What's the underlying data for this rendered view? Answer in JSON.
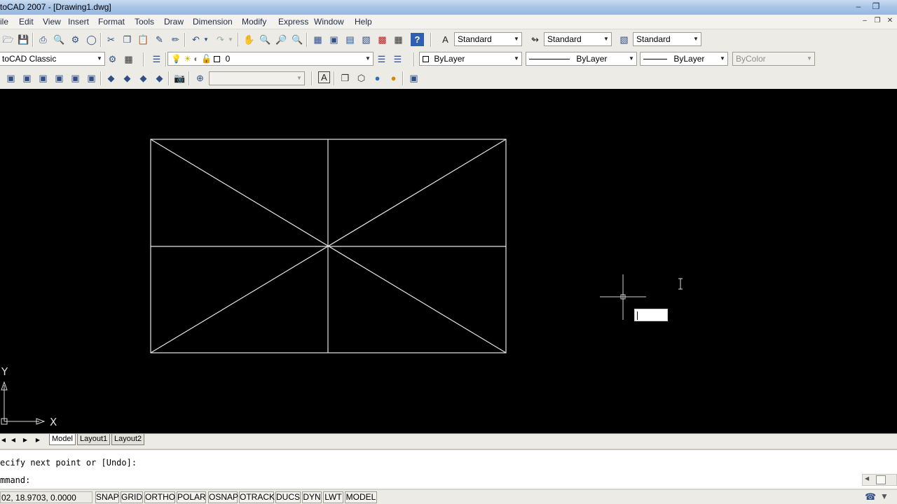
{
  "window": {
    "title": "toCAD 2007 - [Drawing1.dwg]",
    "minimize_icon": "minimize-icon",
    "restore_icon": "restore-icon"
  },
  "menu": {
    "items": [
      "ile",
      "Edit",
      "View",
      "Insert",
      "Format",
      "Tools",
      "Draw",
      "Dimension",
      "Modify",
      "Express",
      "Window",
      "Help"
    ],
    "mdi_controls": [
      "minimize",
      "restore",
      "close"
    ]
  },
  "toolbar_styles": {
    "text_style": "Standard",
    "dim_style": "Standard",
    "table_style": "Standard"
  },
  "toolbar_layers": {
    "workspace": "toCAD Classic",
    "layer": "0",
    "color": "ByLayer",
    "linetype": "ByLayer",
    "lineweight": "ByLayer",
    "plot_style": "ByColor"
  },
  "drawing": {
    "ucs_x": "X",
    "ucs_y": "Y",
    "line_color": "#ffffff",
    "background": "#000000"
  },
  "tabs": {
    "model": "Model",
    "layout1": "Layout1",
    "layout2": "Layout2"
  },
  "command": {
    "history": "ecify next point or [Undo]:",
    "prompt": "mmand:"
  },
  "status": {
    "coordinates": "02, 18.9703, 0.0000",
    "buttons": [
      "SNAP",
      "GRID",
      "ORTHO",
      "POLAR",
      "OSNAP",
      "OTRACK",
      "DUCS",
      "DYN",
      "LWT",
      "MODEL"
    ]
  }
}
